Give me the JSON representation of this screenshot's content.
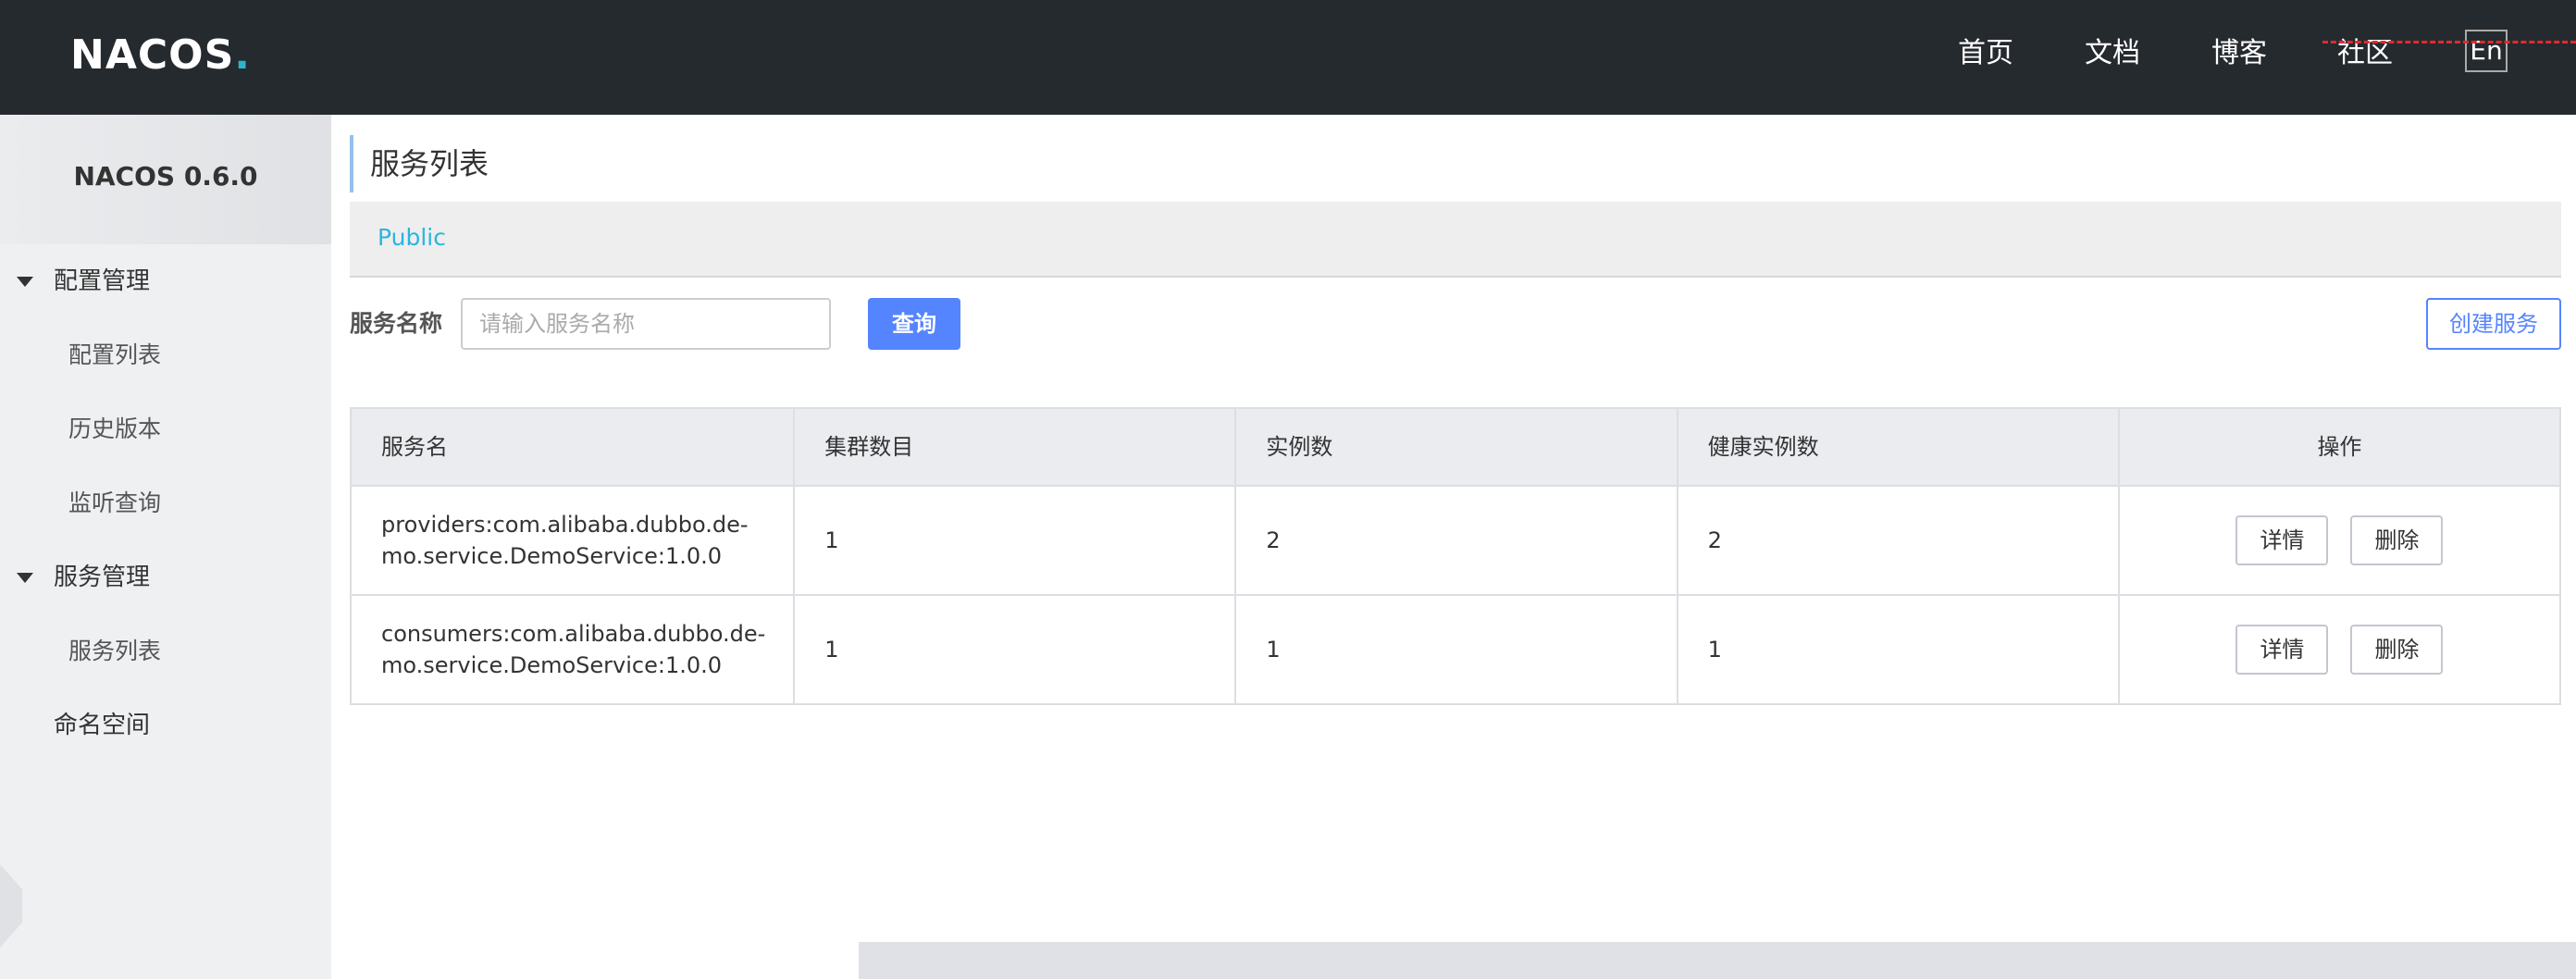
{
  "header": {
    "logo": "NACOS",
    "logo_dot": ".",
    "nav": [
      "首页",
      "文档",
      "博客",
      "社区"
    ],
    "lang": "En"
  },
  "sidebar": {
    "version": "NACOS 0.6.0",
    "groups": [
      {
        "label": "配置管理",
        "expanded": true,
        "items": [
          "配置列表",
          "历史版本",
          "监听查询"
        ]
      },
      {
        "label": "服务管理",
        "expanded": true,
        "items": [
          "服务列表"
        ]
      }
    ],
    "namespace": "命名空间"
  },
  "main": {
    "title": "服务列表",
    "namespace_tab": "Public",
    "search": {
      "label": "服务名称",
      "placeholder": "请输入服务名称",
      "value": "",
      "button": "查询"
    },
    "create_button": "创建服务",
    "table": {
      "columns": [
        "服务名",
        "集群数目",
        "实例数",
        "健康实例数",
        "操作"
      ],
      "rows": [
        {
          "name": "providers:com.alibaba.dubbo.de-\nmo.service.DemoService:1.0.0",
          "clusters": "1",
          "instances": "2",
          "healthy": "2",
          "detail": "详情",
          "delete": "删除"
        },
        {
          "name": "consumers:com.alibaba.dubbo.de-\nmo.service.DemoService:1.0.0",
          "clusters": "1",
          "instances": "1",
          "healthy": "1",
          "detail": "详情",
          "delete": "删除"
        }
      ]
    }
  },
  "colors": {
    "topbar": "#252a2f",
    "primary": "#5584ff",
    "link": "#2cb4e0",
    "watermark": "#e8262d"
  }
}
